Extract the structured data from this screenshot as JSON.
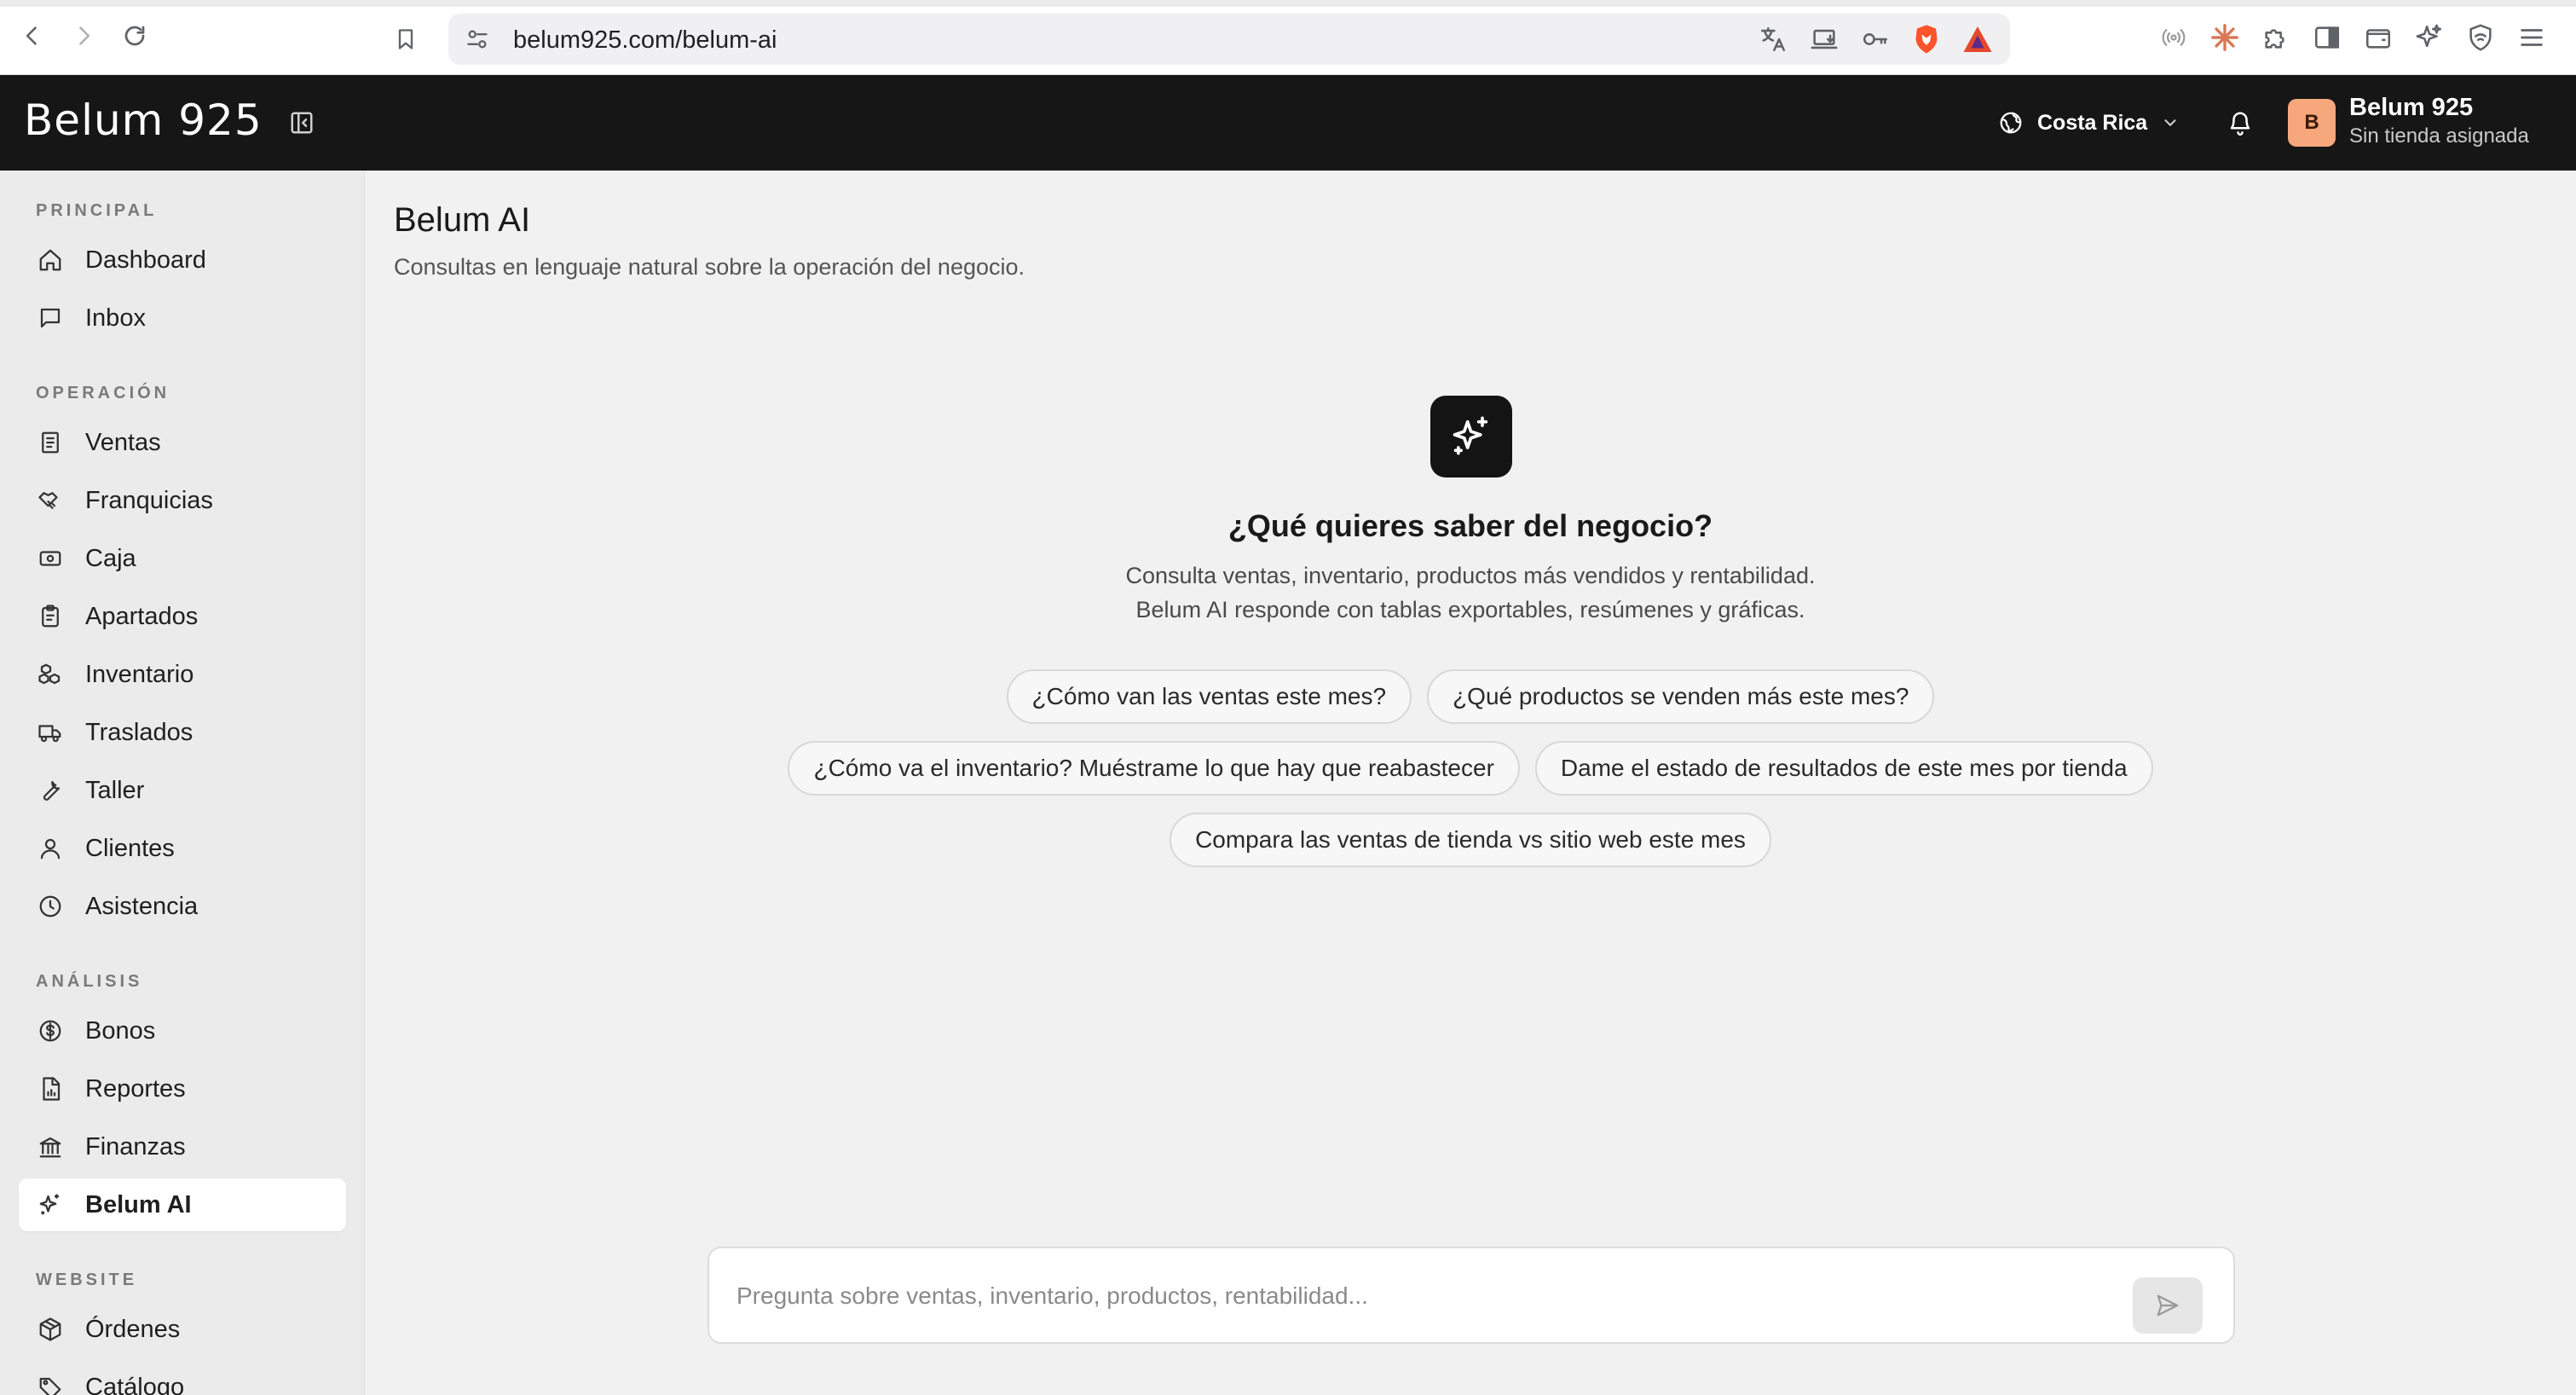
{
  "browser": {
    "url": "belum925.com/belum-ai"
  },
  "header": {
    "brand": "Belum 925",
    "region": "Costa Rica",
    "avatar_initial": "B",
    "user_name": "Belum 925",
    "user_subtitle": "Sin tienda asignada"
  },
  "sidebar": {
    "sections": {
      "principal": "PRINCIPAL",
      "operacion": "OPERACIÓN",
      "analisis": "ANÁLISIS",
      "website": "WEBSITE"
    },
    "items": {
      "dashboard": "Dashboard",
      "inbox": "Inbox",
      "ventas": "Ventas",
      "franquicias": "Franquicias",
      "caja": "Caja",
      "apartados": "Apartados",
      "inventario": "Inventario",
      "traslados": "Traslados",
      "taller": "Taller",
      "clientes": "Clientes",
      "asistencia": "Asistencia",
      "bonos": "Bonos",
      "reportes": "Reportes",
      "finanzas": "Finanzas",
      "belum_ai": "Belum AI",
      "ordenes": "Órdenes",
      "catalogo": "Catálogo"
    }
  },
  "main": {
    "title": "Belum AI",
    "subtitle": "Consultas en lenguaje natural sobre la operación del negocio.",
    "hero_title": "¿Qué quieres saber del negocio?",
    "hero_desc_1": "Consulta ventas, inventario, productos más vendidos y rentabilidad.",
    "hero_desc_2": "Belum AI responde con tablas exportables, resúmenes y gráficas.",
    "suggestions": [
      "¿Cómo van las ventas este mes?",
      "¿Qué productos se venden más este mes?",
      "¿Cómo va el inventario? Muéstrame lo que hay que reabastecer",
      "Dame el estado de resultados de este mes por tienda",
      "Compara las ventas de tienda vs sitio web este mes"
    ],
    "composer_placeholder": "Pregunta sobre ventas, inventario, productos, rentabilidad..."
  }
}
